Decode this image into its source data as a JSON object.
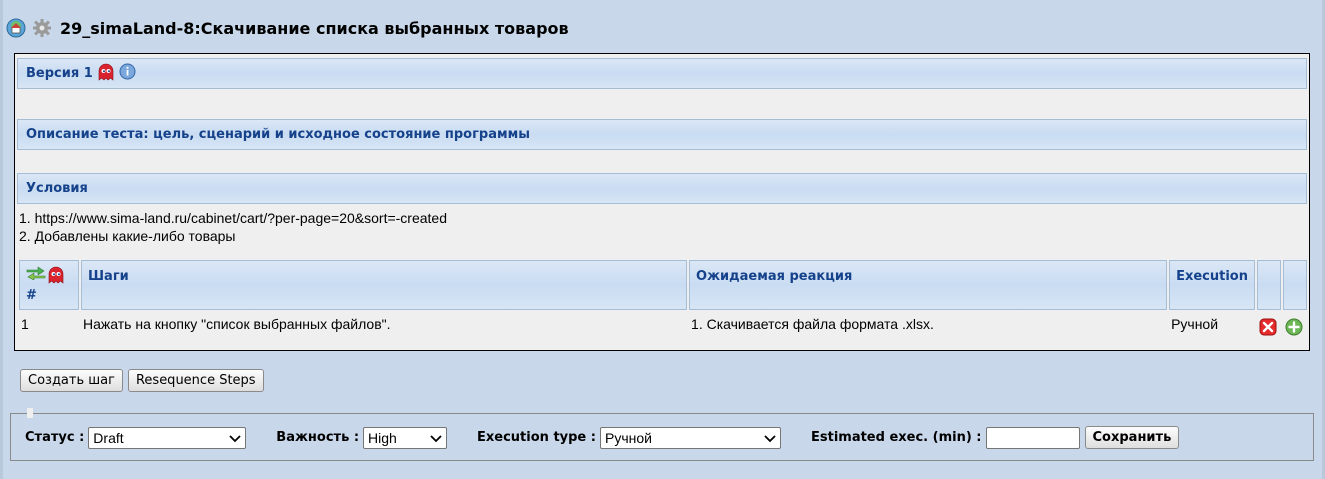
{
  "header": {
    "title": "29_simaLand-8:Скачивание списка выбранных товаров",
    "icons": [
      "home-icon",
      "gear-icon"
    ]
  },
  "sections": {
    "version": {
      "label": "Версия 1",
      "icons": [
        "ghost-icon",
        "info-icon"
      ]
    },
    "description": {
      "label": "Описание теста: цель, сценарий и исходное состояние программы"
    },
    "conditions": {
      "label": "Условия",
      "lines": [
        "1. https://www.sima-land.ru/cabinet/cart/?per-page=20&sort=-created",
        "2. Добавлены какие-либо товары"
      ]
    }
  },
  "steps": {
    "headers": {
      "num": "#",
      "steps": "Шаги",
      "expected": "Ожидаемая реакция",
      "execution": "Execution"
    },
    "header_icons": [
      "resequence-icon",
      "ghost-icon"
    ],
    "rows": [
      {
        "num": "1",
        "step": "Нажать на кнопку \"список выбранных файлов\".",
        "expected": "1. Скачивается файла формата .xlsx.",
        "execution": "Ручной",
        "icons": [
          "delete-icon",
          "add-icon"
        ]
      }
    ]
  },
  "buttons": {
    "create_step": "Создать шаг",
    "resequence": "Resequence Steps"
  },
  "form": {
    "status_label": "Статус :",
    "status_value": "Draft",
    "importance_label": "Важность :",
    "importance_value": "High",
    "exec_type_label": "Execution type :",
    "exec_type_value": "Ручной",
    "estimated_label": "Estimated exec. (min) :",
    "estimated_value": "",
    "save_label": "Сохранить"
  },
  "colors": {
    "background": "#c8d8ea",
    "header_text": "#15428b",
    "panel": "#efefef"
  }
}
